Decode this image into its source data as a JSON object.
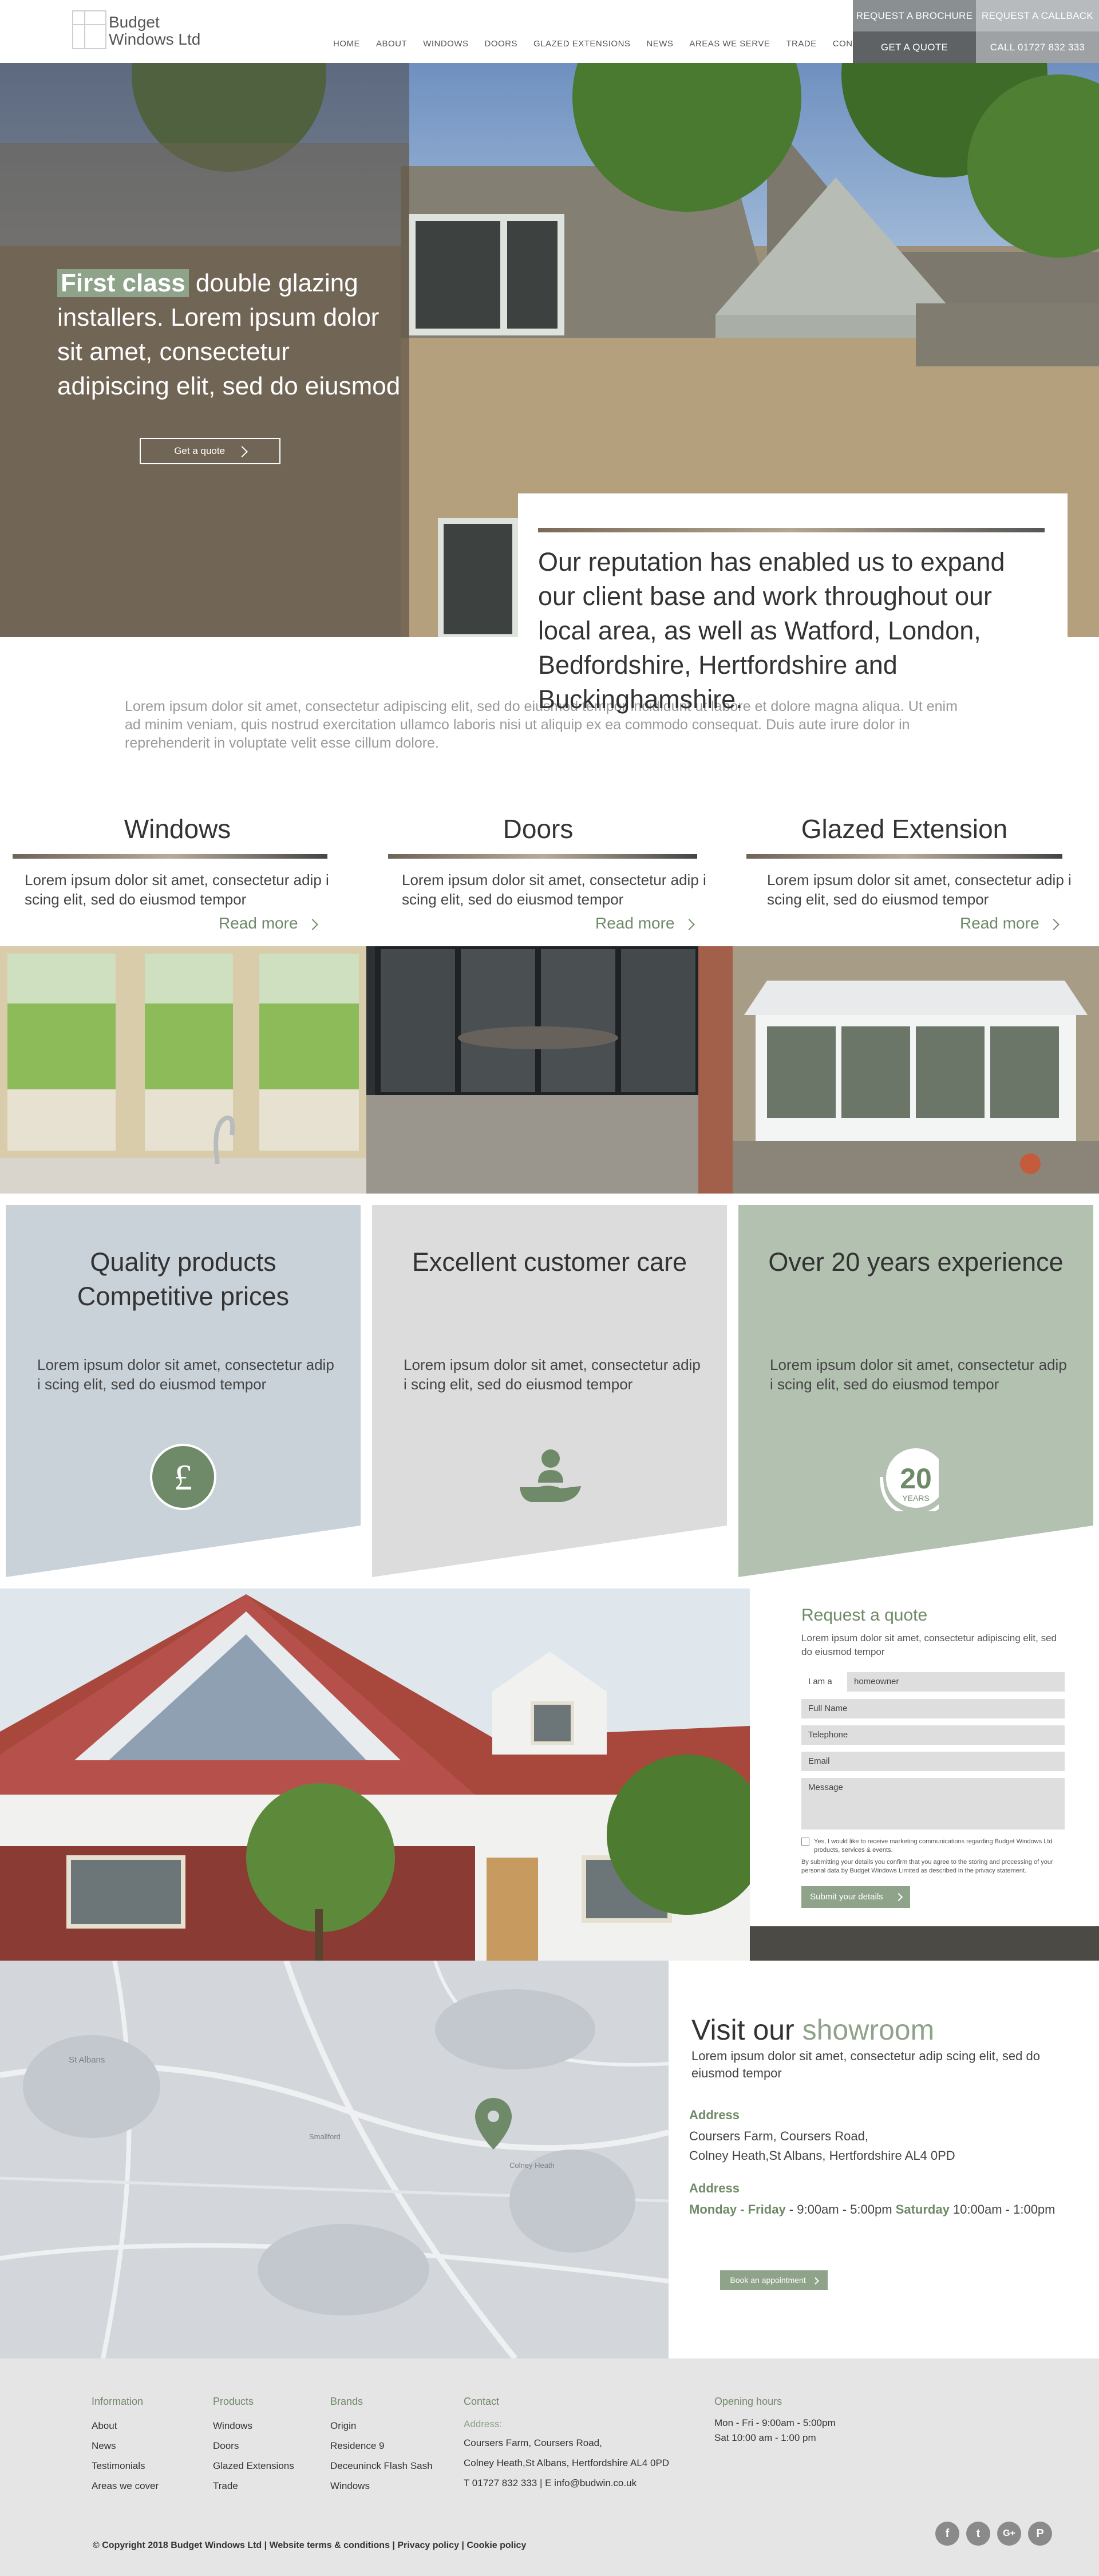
{
  "logo": {
    "line1": "Budget",
    "line2": "Windows Ltd"
  },
  "nav": [
    "HOME",
    "ABOUT",
    "WINDOWS",
    "DOORS",
    "GLAZED EXTENSIONS",
    "NEWS",
    "AREAS WE SERVE",
    "TRADE",
    "CONTACT"
  ],
  "header_buttons": {
    "brochure": "REQUEST A BROCHURE",
    "callback": "REQUEST A CALLBACK",
    "quote": "GET A QUOTE",
    "call": "CALL 01727 832 333"
  },
  "hero": {
    "highlight": "First class",
    "title_rest": " double glazing installers. Lorem ipsum dolor sit amet, consectetur adipiscing elit, sed do eiusmod",
    "button": "Get a quote"
  },
  "reputation": "Our reputation has enabled us to expand our client base and work throughout our local area, as well as Watford, London, Bedfordshire, Hertfordshire and Buckinghamshire.",
  "intro_lorem": "Lorem ipsum dolor sit amet, consectetur adipiscing elit, sed do eiusmod tempor incididunt ut labore et dolore magna aliqua. Ut enim ad minim veniam, quis nostrud exercitation ullamco laboris nisi ut aliquip ex ea commodo consequat. Duis aute irure dolor in reprehenderit in voluptate velit esse cillum dolore.",
  "products": [
    {
      "title": "Windows",
      "desc": "Lorem ipsum dolor sit amet, consectetur adip i scing elit, sed do eiusmod tempor",
      "more": "Read more"
    },
    {
      "title": "Doors",
      "desc": "Lorem ipsum dolor sit amet, consectetur adip i scing elit, sed do eiusmod tempor",
      "more": "Read more"
    },
    {
      "title": "Glazed Extension",
      "desc": "Lorem ipsum dolor sit amet, consectetur adip i scing elit, sed do eiusmod tempor",
      "more": "Read more"
    }
  ],
  "features": [
    {
      "title_line1": "Quality products",
      "title_line2": "Competitive prices",
      "desc": "Lorem ipsum dolor sit amet, consectetur adip i scing elit, sed do eiusmod tempor",
      "icon": "pound-icon"
    },
    {
      "title_line1": "Excellent customer care",
      "title_line2": "",
      "desc": "Lorem ipsum dolor sit amet, consectetur adip i scing elit, sed do eiusmod tempor",
      "icon": "care-icon"
    },
    {
      "title_line1": "Over 20 years experience",
      "title_line2": "",
      "desc": "Lorem ipsum dolor sit amet, consectetur adip i scing elit, sed do eiusmod tempor",
      "icon": "twenty-years-icon",
      "badge_number": "20",
      "badge_text": "YEARS"
    }
  ],
  "quote_form": {
    "title": "Request a quote",
    "subtitle": "Lorem ipsum dolor sit amet, consectetur adipiscing elit, sed do eiusmod tempor",
    "iam_label": "I am a",
    "iam_value": "homeowner",
    "full_name": "Full Name",
    "telephone": "Telephone",
    "email": "Email",
    "message": "Message",
    "consent1": "Yes, I would like to receive marketing communications regarding Budget Windows Ltd products, services & events.",
    "consent2": "By submitting your details you confirm that you agree to the storing and processing of your personal data by Budget Windows Limited as described in the privacy statement.",
    "submit": "Submit your details"
  },
  "showroom": {
    "title_a": "Visit our ",
    "title_b": "showroom",
    "desc": "Lorem ipsum dolor sit amet, consectetur adip scing elit, sed do eiusmod tempor",
    "address_label": "Address",
    "address_line1": "Coursers Farm, Coursers Road,",
    "address_line2": "Colney Heath,St Albans, Hertfordshire AL4 0PD",
    "hours_label": "Address",
    "hours_days": "Monday - Friday",
    "hours_time": " - 9:00am - 5:00pm ",
    "hours_sat": "Saturday",
    "hours_sat_time": " 10:00am - 1:00pm",
    "button": "Book an appointment"
  },
  "map_labels": [
    "St Albans",
    "Colney Heath",
    "Smallford"
  ],
  "footer": {
    "information": {
      "heading": "Information",
      "items": [
        "About",
        "News",
        "Testimonials",
        "Areas we cover"
      ]
    },
    "products": {
      "heading": "Products",
      "items": [
        "Windows",
        "Doors",
        "Glazed Extensions",
        "Trade"
      ]
    },
    "brands": {
      "heading": "Brands",
      "items": [
        "Origin",
        "Residence 9",
        "Deceuninck Flash Sash",
        "Windows"
      ]
    },
    "contact": {
      "heading": "Contact",
      "address_label": "Address:",
      "line1": "Coursers Farm, Coursers Road,",
      "line2": "Colney Heath,St Albans, Hertfordshire AL4 0PD",
      "line3": "T 01727 832 333 | E info@budwin.co.uk"
    },
    "hours": {
      "heading": "Opening hours",
      "line1": "Mon - Fri - 9:00am - 5:00pm",
      "line2": "Sat 10:00 am - 1:00 pm"
    },
    "copyright": "© Copyright 2018 Budget Windows Ltd | Website terms & conditions | Privacy policy | Cookie policy",
    "social": [
      "f",
      "t",
      "G+",
      "P"
    ]
  },
  "colors": {
    "accent_green": "#8ea38a",
    "dark_green": "#6f8a68",
    "panel_blue": "#c9d1d9",
    "panel_grey": "#dcdcdc",
    "panel_green": "#b3c2b0"
  }
}
